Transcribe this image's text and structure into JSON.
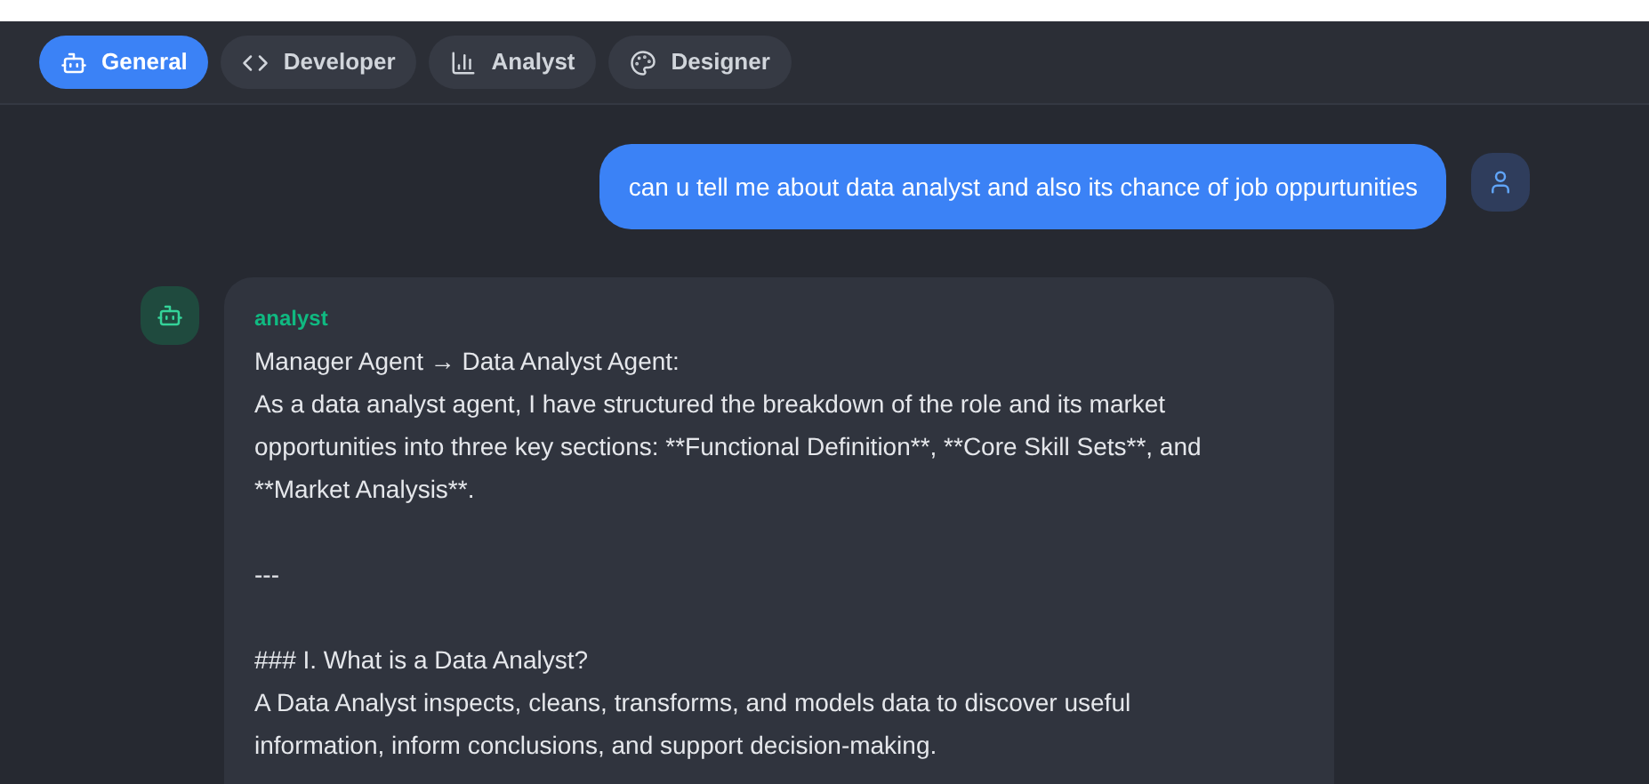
{
  "tabs": [
    {
      "label": "General",
      "selected": true
    },
    {
      "label": "Developer",
      "selected": false
    },
    {
      "label": "Analyst",
      "selected": false
    },
    {
      "label": "Designer",
      "selected": false
    }
  ],
  "messages": [
    {
      "kind": "user",
      "text": "can u tell me about data analyst and also its chance of job oppurtunities"
    },
    {
      "kind": "agent",
      "sender": "analyst",
      "blocks": [
        [
          "Manager Agent → Data Analyst Agent:",
          "As a data analyst agent, I have structured the breakdown of the role and its market",
          "opportunities into three key sections: **Functional Definition**, **Core Skill Sets**, and",
          "**Market Analysis**."
        ],
        [
          "---"
        ],
        [
          "### I. What is a Data Analyst?",
          "A Data Analyst inspects, cleans, transforms, and models data to discover useful",
          "information, inform conclusions, and support decision-making."
        ]
      ]
    }
  ]
}
